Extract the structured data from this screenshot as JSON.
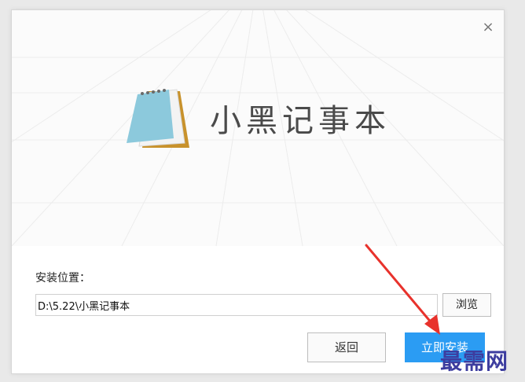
{
  "app": {
    "title": "小黑记事本",
    "close_symbol": "×"
  },
  "install": {
    "location_label": "安装位置：",
    "path_value": "D:\\5.22\\小黑记事本",
    "browse_label": "浏览",
    "back_label": "返回",
    "install_label": "立即安装"
  },
  "watermark": "最需网",
  "colors": {
    "accent": "#2b9cf3",
    "arrow": "#e8322c",
    "title_text": "#4a4a4a"
  },
  "icons": [
    "notepad-logo-icon",
    "close-icon",
    "red-arrow-annotation"
  ]
}
